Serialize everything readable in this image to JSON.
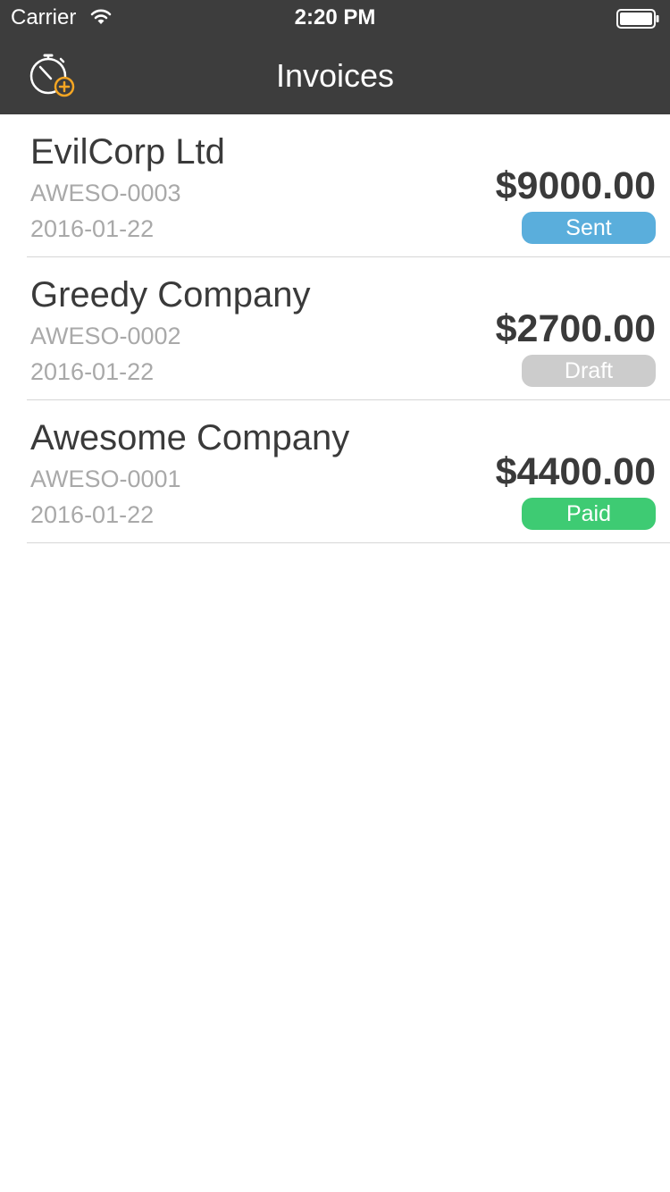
{
  "status_bar": {
    "carrier": "Carrier",
    "time": "2:20 PM",
    "icons": [
      "wifi-icon",
      "battery-icon"
    ]
  },
  "nav": {
    "title": "Invoices",
    "left_icon": "timer-add-icon",
    "accent_color": "#f5a623"
  },
  "invoices": [
    {
      "client": "EvilCorp Ltd",
      "number": "AWESO-0003",
      "date": "2016-01-22",
      "amount": "$9000.00",
      "status": "Sent",
      "status_color": "#5aaedc"
    },
    {
      "client": "Greedy Company",
      "number": "AWESO-0002",
      "date": "2016-01-22",
      "amount": "$2700.00",
      "status": "Draft",
      "status_color": "#cccccc"
    },
    {
      "client": "Awesome Company",
      "number": "AWESO-0001",
      "date": "2016-01-22",
      "amount": "$4400.00",
      "status": "Paid",
      "status_color": "#3ecb73"
    }
  ]
}
